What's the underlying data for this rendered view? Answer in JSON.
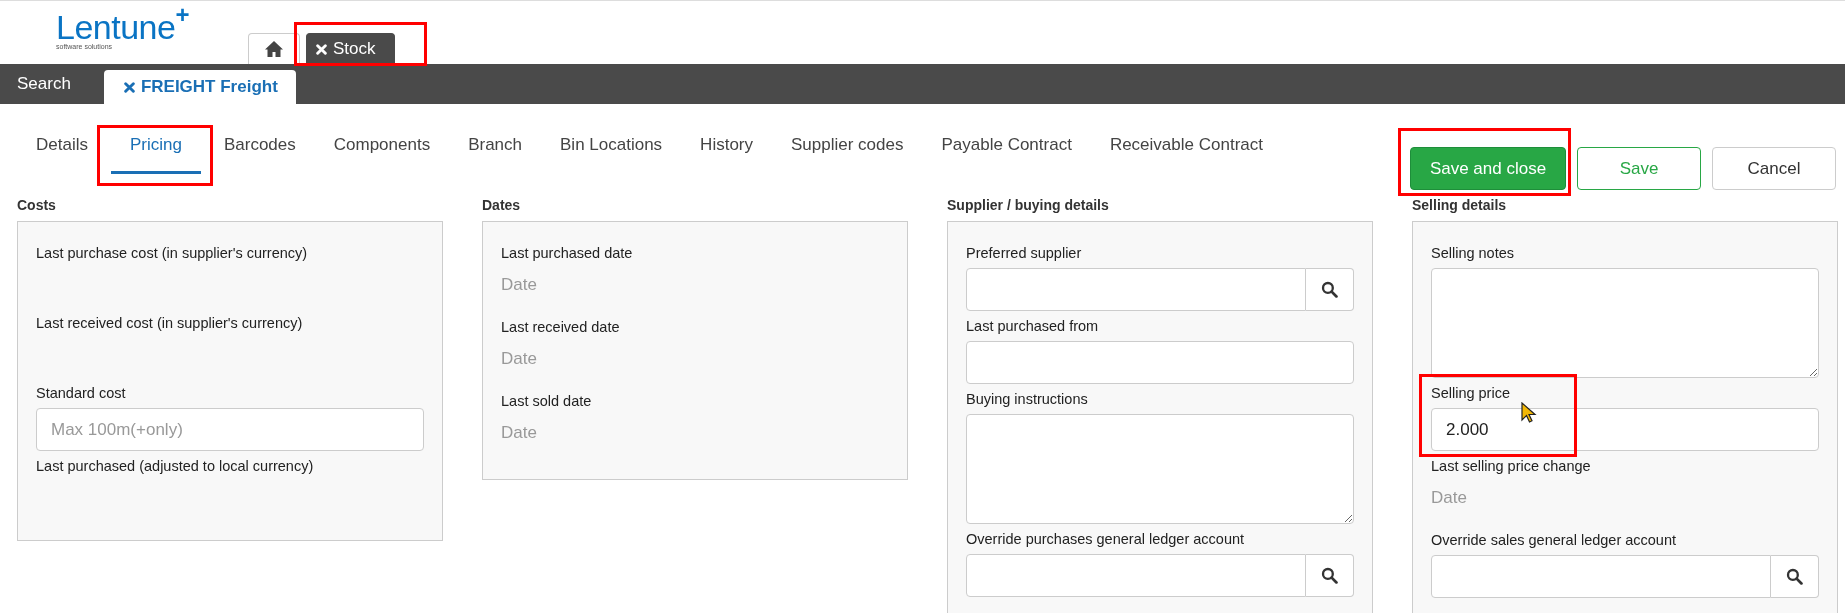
{
  "logo": {
    "name": "Lentune",
    "mark": "+",
    "tagline": "software solutions"
  },
  "top_tabs": [
    {
      "kind": "home",
      "selected": false,
      "highlighted": false
    },
    {
      "kind": "module",
      "label": "Stock",
      "selected": true,
      "highlighted": true
    }
  ],
  "record_tabs": [
    {
      "label": "Search",
      "selected": false,
      "closable": false
    },
    {
      "label": "FREIGHT Freight",
      "selected": true,
      "closable": true
    }
  ],
  "subtabs": [
    {
      "label": "Details",
      "selected": false,
      "highlighted": false
    },
    {
      "label": "Pricing",
      "selected": true,
      "highlighted": true
    },
    {
      "label": "Barcodes",
      "selected": false,
      "highlighted": false
    },
    {
      "label": "Components",
      "selected": false,
      "highlighted": false
    },
    {
      "label": "Branch",
      "selected": false,
      "highlighted": false
    },
    {
      "label": "Bin Locations",
      "selected": false,
      "highlighted": false
    },
    {
      "label": "History",
      "selected": false,
      "highlighted": false
    },
    {
      "label": "Supplier codes",
      "selected": false,
      "highlighted": false
    },
    {
      "label": "Payable Contract",
      "selected": false,
      "highlighted": false
    },
    {
      "label": "Receivable Contract",
      "selected": false,
      "highlighted": false
    }
  ],
  "buttons": [
    {
      "label": "Save and close",
      "kind": "primary",
      "highlighted": true
    },
    {
      "label": "Save",
      "kind": "outline",
      "highlighted": false
    },
    {
      "label": "Cancel",
      "kind": "default",
      "highlighted": false
    }
  ],
  "sections": [
    {
      "title": "Costs",
      "fields": [
        {
          "kind": "text",
          "label": "Last purchase cost (in supplier's currency)"
        },
        {
          "kind": "text",
          "label": "Last received cost (in supplier's currency)"
        },
        {
          "kind": "input",
          "label": "Standard cost",
          "placeholder": "Max 100m(+only)"
        },
        {
          "kind": "text",
          "label": "Last purchased (adjusted to local currency)"
        }
      ]
    },
    {
      "title": "Dates",
      "fields": [
        {
          "kind": "date",
          "label": "Last purchased date",
          "placeholder": "Date"
        },
        {
          "kind": "date",
          "label": "Last received date",
          "placeholder": "Date"
        },
        {
          "kind": "date",
          "label": "Last sold date",
          "placeholder": "Date"
        }
      ]
    },
    {
      "title": "Supplier / buying details",
      "fields": [
        {
          "kind": "lookup",
          "label": "Preferred supplier"
        },
        {
          "kind": "input",
          "label": "Last purchased from"
        },
        {
          "kind": "textarea",
          "label": "Buying instructions"
        },
        {
          "kind": "lookup",
          "label": "Override purchases general ledger account"
        }
      ]
    },
    {
      "title": "Selling details",
      "fields": [
        {
          "kind": "textarea",
          "label": "Selling notes"
        },
        {
          "kind": "input",
          "label": "Selling price",
          "value": "2.000",
          "highlighted": true
        },
        {
          "kind": "date",
          "label": "Last selling price change",
          "placeholder": "Date"
        },
        {
          "kind": "lookup",
          "label": "Override sales general ledger account"
        }
      ]
    }
  ]
}
